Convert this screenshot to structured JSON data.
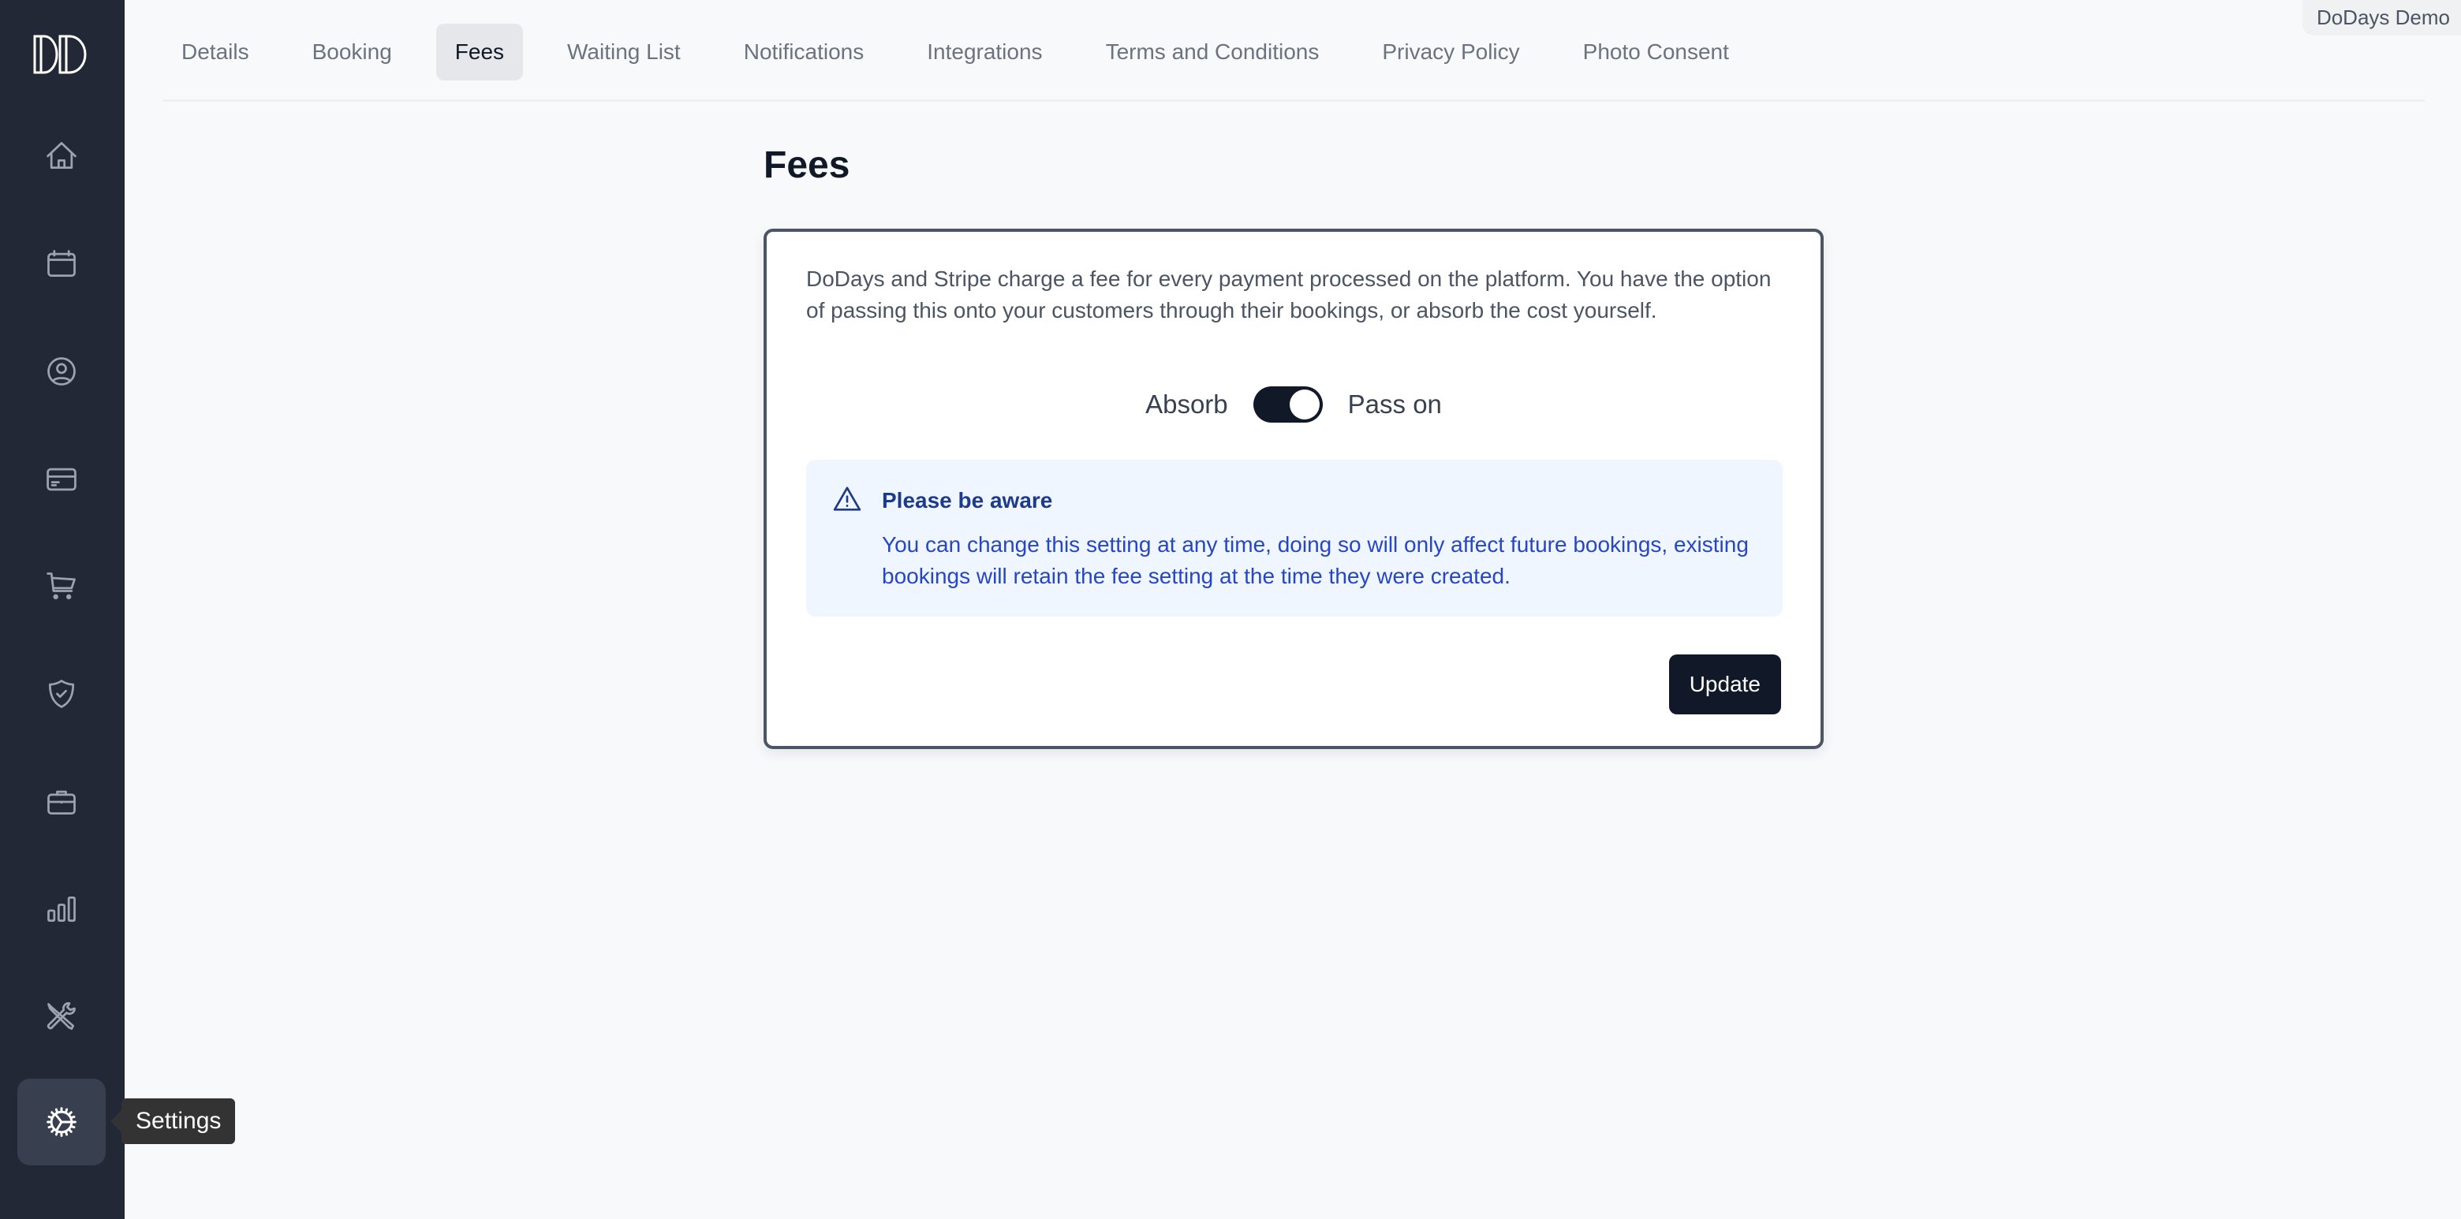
{
  "app": {
    "logo_text": "DD",
    "account_name": "DoDays Demo"
  },
  "sidebar": {
    "items": [
      {
        "name": "home",
        "icon": "home-icon"
      },
      {
        "name": "calendar",
        "icon": "calendar-icon"
      },
      {
        "name": "customers",
        "icon": "user-circle-icon"
      },
      {
        "name": "payments",
        "icon": "credit-card-icon"
      },
      {
        "name": "shop",
        "icon": "cart-icon"
      },
      {
        "name": "security",
        "icon": "shield-check-icon"
      },
      {
        "name": "business",
        "icon": "briefcase-icon"
      },
      {
        "name": "reports",
        "icon": "bar-chart-icon"
      },
      {
        "name": "tools",
        "icon": "tools-icon"
      },
      {
        "name": "settings",
        "icon": "gear-icon",
        "active": true
      }
    ],
    "tooltip": "Settings"
  },
  "tabs": [
    {
      "label": "Details"
    },
    {
      "label": "Booking"
    },
    {
      "label": "Fees",
      "active": true
    },
    {
      "label": "Waiting List"
    },
    {
      "label": "Notifications"
    },
    {
      "label": "Integrations"
    },
    {
      "label": "Terms and Conditions"
    },
    {
      "label": "Privacy Policy"
    },
    {
      "label": "Photo Consent"
    }
  ],
  "page": {
    "title": "Fees",
    "description": "DoDays and Stripe charge a fee for every payment processed on the platform. You have the option of passing this onto your customers through their bookings, or absorb the cost yourself.",
    "toggle": {
      "left_label": "Absorb",
      "right_label": "Pass on",
      "value": "Pass on"
    },
    "alert": {
      "icon": "warning-icon",
      "title": "Please be aware",
      "body": "You can change this setting at any time, doing so will only affect future bookings, existing bookings will retain the fee setting at the time they were created."
    },
    "update_label": "Update"
  },
  "colors": {
    "sidebar_bg": "#222836",
    "primary": "#111827",
    "alert_bg": "#eff6ff",
    "alert_text": "#2746c4"
  }
}
